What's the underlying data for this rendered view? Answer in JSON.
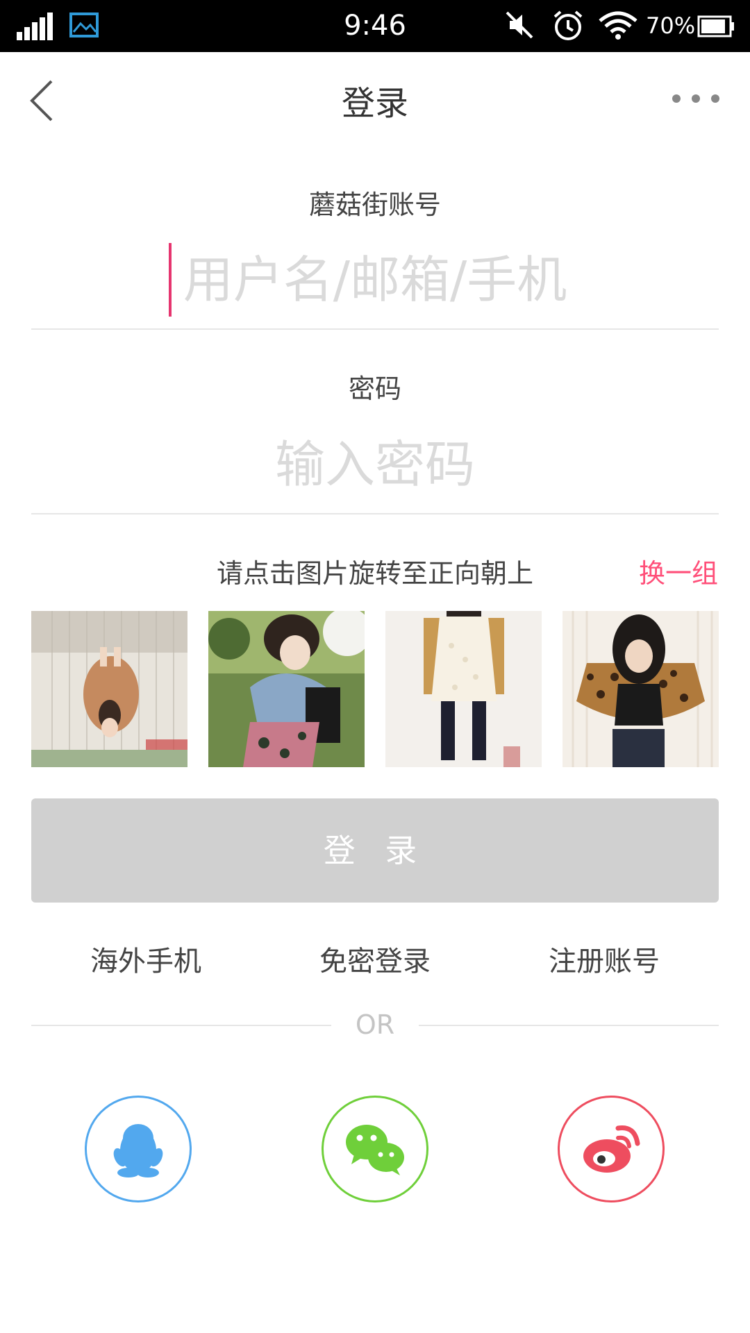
{
  "status_bar": {
    "time": "9:46",
    "battery_text": "70%",
    "icons": [
      "signal-icon",
      "gallery-icon",
      "mute-icon",
      "alarm-icon",
      "wifi-icon",
      "battery-icon"
    ]
  },
  "header": {
    "title": "登录",
    "back_icon": "chevron-left-icon",
    "more_icon": "more-dots-icon"
  },
  "account_field": {
    "label": "蘑菇街账号",
    "value": "",
    "placeholder": "用户名/邮箱/手机"
  },
  "password_field": {
    "label": "密码",
    "value": "",
    "placeholder": "输入密码"
  },
  "captcha": {
    "hint": "请点击图片旋转至正向朝上",
    "refresh_label": "换一组",
    "tiles": [
      {
        "name": "photo-tile-1",
        "rotation_deg": 90
      },
      {
        "name": "photo-tile-2",
        "rotation_deg": 0
      },
      {
        "name": "photo-tile-3",
        "rotation_deg": 0
      },
      {
        "name": "photo-tile-4",
        "rotation_deg": 180
      }
    ]
  },
  "login_button": {
    "label": "登 录"
  },
  "links": {
    "overseas": "海外手机",
    "passwordless": "免密登录",
    "register": "注册账号"
  },
  "separator": {
    "text": "OR"
  },
  "social": [
    {
      "name": "qq",
      "icon": "qq-penguin-icon",
      "color": "#52a8ee"
    },
    {
      "name": "wechat",
      "icon": "wechat-icon",
      "color": "#6fcf3a"
    },
    {
      "name": "weibo",
      "icon": "weibo-icon",
      "color": "#ee4d5f"
    }
  ],
  "colors": {
    "accent": "#ff4f79",
    "caret": "#e6356f",
    "button_disabled": "#d0d0d0",
    "divider": "#e6e6e6"
  }
}
